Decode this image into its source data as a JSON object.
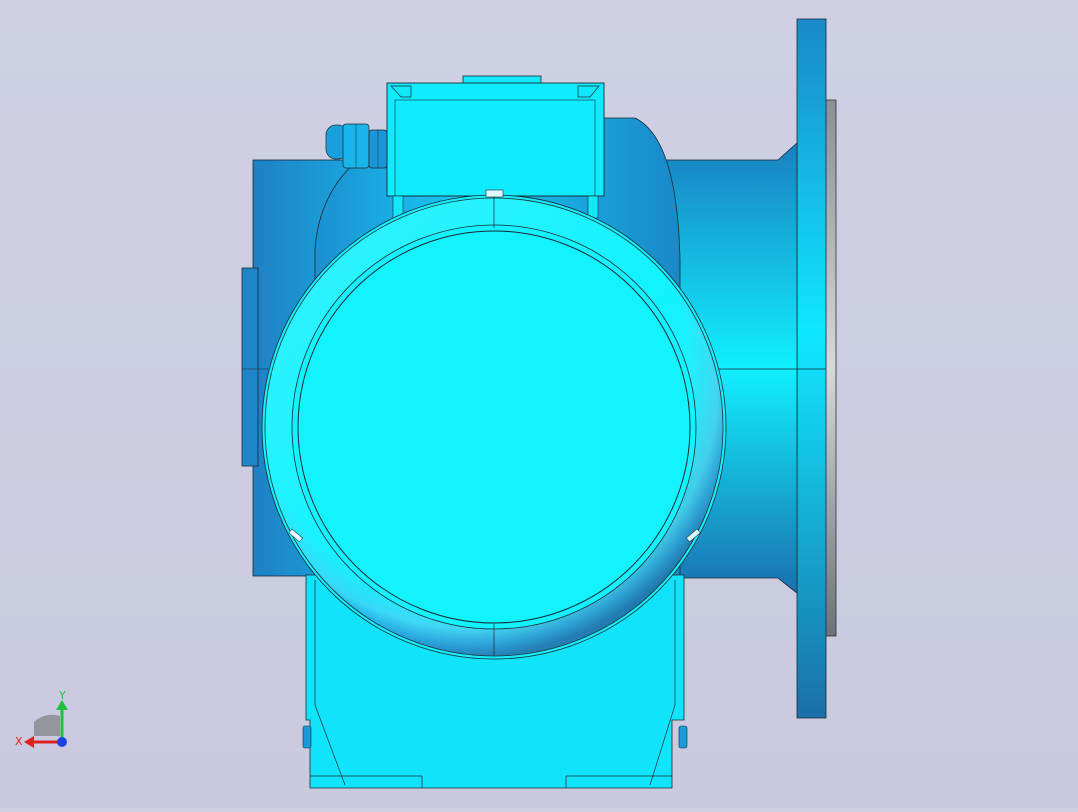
{
  "viewport": {
    "background_color": "#cdcee2",
    "model_color": "#12f3ff",
    "model_shade_color": "#1a8fd0",
    "outline_color": "#1a2a30"
  },
  "triad": {
    "x_label": "X",
    "y_label": "Y",
    "x_color": "#e02020",
    "y_color": "#22c040",
    "z_color": "#2040e0",
    "icons": [
      "coordinate-triad-icon"
    ]
  }
}
